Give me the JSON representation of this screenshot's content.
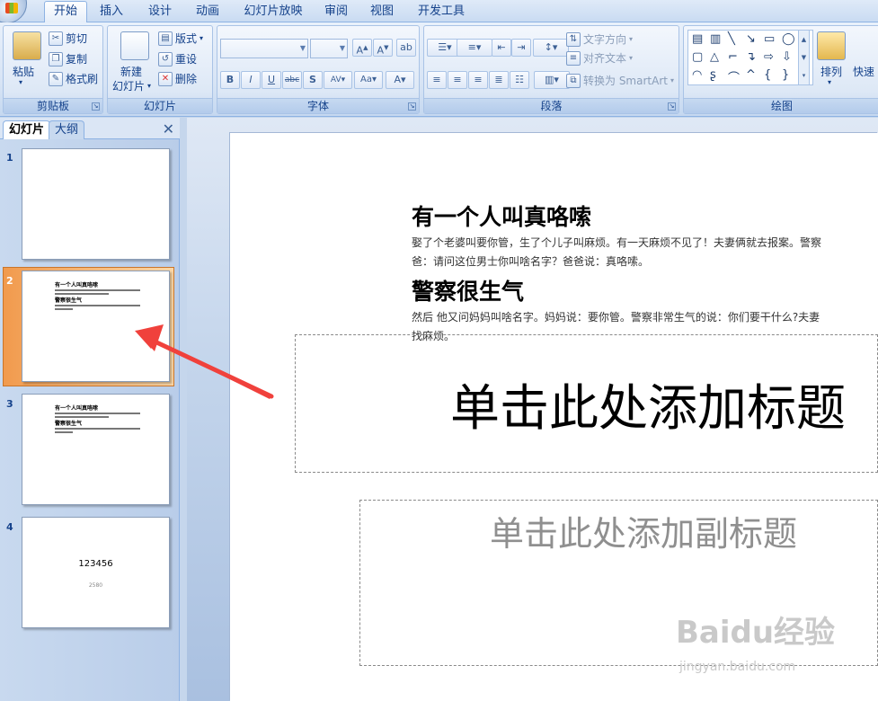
{
  "tabs": [
    {
      "label": "开始"
    },
    {
      "label": "插入"
    },
    {
      "label": "设计"
    },
    {
      "label": "动画"
    },
    {
      "label": "幻灯片放映"
    },
    {
      "label": "审阅"
    },
    {
      "label": "视图"
    },
    {
      "label": "开发工具"
    }
  ],
  "ribbon": {
    "clipboard": {
      "paste": "粘贴",
      "cut": "剪切",
      "copy": "复制",
      "format_painter": "格式刷",
      "label": "剪贴板"
    },
    "slides": {
      "new_slide_line1": "新建",
      "new_slide_line2": "幻灯片",
      "layout": "版式",
      "reset": "重设",
      "delete": "删除",
      "label": "幻灯片"
    },
    "font": {
      "label": "字体"
    },
    "paragraph": {
      "text_direction": "文字方向",
      "align_text": "对齐文本",
      "smartart": "转换为 SmartArt",
      "label": "段落"
    },
    "drawing": {
      "arrange": "排列",
      "quick_styles": "快速",
      "label": "绘图"
    }
  },
  "pane": {
    "tab_slides": "幻灯片",
    "tab_outline": "大纲",
    "close": "✕",
    "slides": [
      {
        "num": "1"
      },
      {
        "num": "2"
      },
      {
        "num": "3"
      },
      {
        "num": "4",
        "title": "123456",
        "subtitle": "2580"
      }
    ]
  },
  "slide": {
    "heading1": "有一个人叫真咯嗦",
    "para1_line1": "娶了个老婆叫要你管，生了个儿子叫麻烦。有一天麻烦不见了！夫妻俩就去报案。警察",
    "para1_line2": "爸：请问这位男士你叫啥名字？爸爸说：真咯嗦。",
    "heading2": "警察很生气",
    "para2_line1": "然后 他又问妈妈叫啥名字。妈妈说：要你管。警察非常生气的说：你们要干什么?夫妻",
    "para2_line2": "找麻烦。",
    "title_placeholder": "单击此处添加标题",
    "subtitle_placeholder": "单击此处添加副标题"
  },
  "watermark": {
    "brand": "Baidu经验",
    "url": "jingyan.baidu.com"
  },
  "colors": {
    "accent": "#15428b",
    "highlight": "#f19a4d",
    "arrow": "#f0413c"
  }
}
